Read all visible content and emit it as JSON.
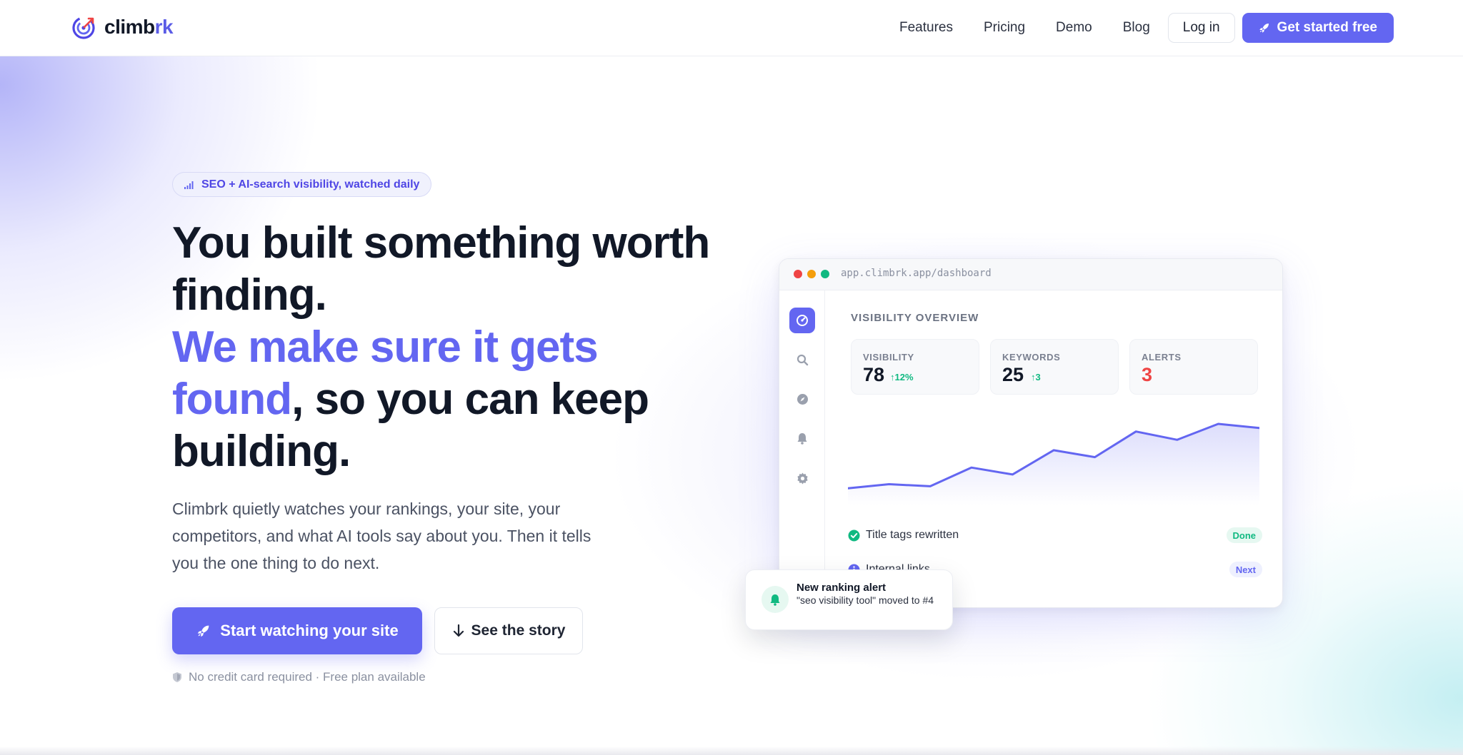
{
  "brand": {
    "name_prefix": "climb",
    "name_suffix": "rk",
    "accent_color": "#6366f1",
    "logo_icon": "target-arrow-icon"
  },
  "nav": {
    "links": [
      "Features",
      "Pricing",
      "Demo",
      "Blog"
    ],
    "login_label": "Log in",
    "cta_label": "Get started free",
    "cta_icon": "rocket-icon"
  },
  "hero": {
    "badge_text": "SEO + AI-search visibility, watched daily",
    "badge_icon": "signal-bars-icon",
    "headline_line1": "You built something worth finding.",
    "headline_accent": "We make sure it gets found",
    "headline_tail": ", so you can keep building.",
    "subtext": "Climbrk quietly watches your rankings, your site, your competitors, and what AI tools say about you. Then it tells you the one thing to do next.",
    "primary_cta": "Start watching your site",
    "secondary_cta": "See the story",
    "footnote": "No credit card required · Free plan available"
  },
  "dashboard": {
    "url": "app.climbrk.app/dashboard",
    "title": "VISIBILITY OVERVIEW",
    "stats": [
      {
        "label": "VISIBILITY",
        "value": "78",
        "delta": "12%"
      },
      {
        "label": "KEYWORDS",
        "value": "25",
        "delta": "3"
      },
      {
        "label": "ALERTS",
        "value": "3",
        "delta": ""
      }
    ],
    "alert_color": "#ef4444",
    "positive_color": "#10b981",
    "sidebar_icons": [
      "dashboard-icon",
      "search-icon",
      "compass-icon",
      "bell-icon",
      "gear-icon"
    ],
    "tasks": [
      {
        "label": "Title tags rewritten",
        "status": "Done"
      },
      {
        "label": "Internal links",
        "status": "Next"
      }
    ],
    "trend": [
      10,
      16,
      13,
      40,
      30,
      65,
      55,
      92,
      80,
      103,
      97
    ]
  },
  "notification": {
    "title": "New ranking alert",
    "body": "\"seo visibility tool\" moved to #4",
    "icon": "bell-icon"
  }
}
